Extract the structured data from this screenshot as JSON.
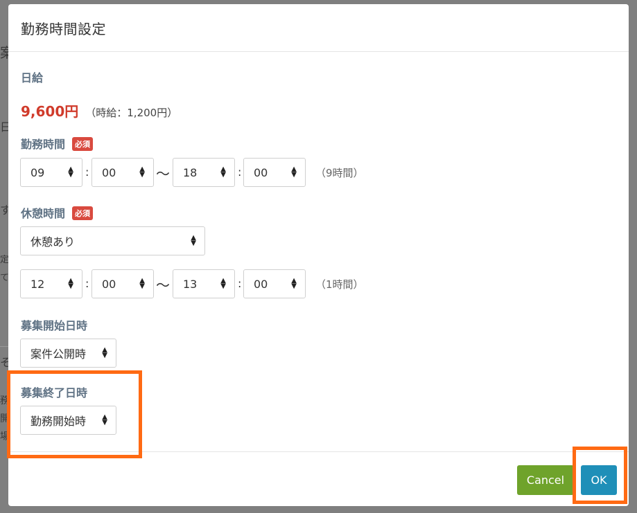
{
  "background_fragments": [
    "案",
    "日",
    "す",
    "定",
    "て",
    "そ",
    "務",
    "開",
    "場"
  ],
  "modal": {
    "title": "勤務時間設定",
    "daily_wage": {
      "label": "日給",
      "amount": "9,600円",
      "hourly_note": "（時給：1,200円）"
    },
    "work_time": {
      "label": "勤務時間",
      "required_badge": "必須",
      "start_hour": "09",
      "start_minute": "00",
      "end_hour": "18",
      "end_minute": "00",
      "colon": ":",
      "tilde": "〜",
      "duration": "（9時間）"
    },
    "break_time": {
      "label": "休憩時間",
      "required_badge": "必須",
      "mode": "休憩あり",
      "start_hour": "12",
      "start_minute": "00",
      "end_hour": "13",
      "end_minute": "00",
      "duration": "（1時間）"
    },
    "recruit_start": {
      "label": "募集開始日時",
      "value": "案件公開時"
    },
    "recruit_end": {
      "label": "募集終了日時",
      "value": "勤務開始時"
    },
    "footer": {
      "cancel_label": "Cancel",
      "ok_label": "OK"
    }
  },
  "colors": {
    "overlay": "#7f7f7f",
    "wage_red": "#d03b2b",
    "label_slate": "#5f7284",
    "badge_red": "#d94a3f",
    "cancel_green": "#6fa32b",
    "ok_blue": "#1f8fb8",
    "highlight_orange": "#ff6a13"
  }
}
